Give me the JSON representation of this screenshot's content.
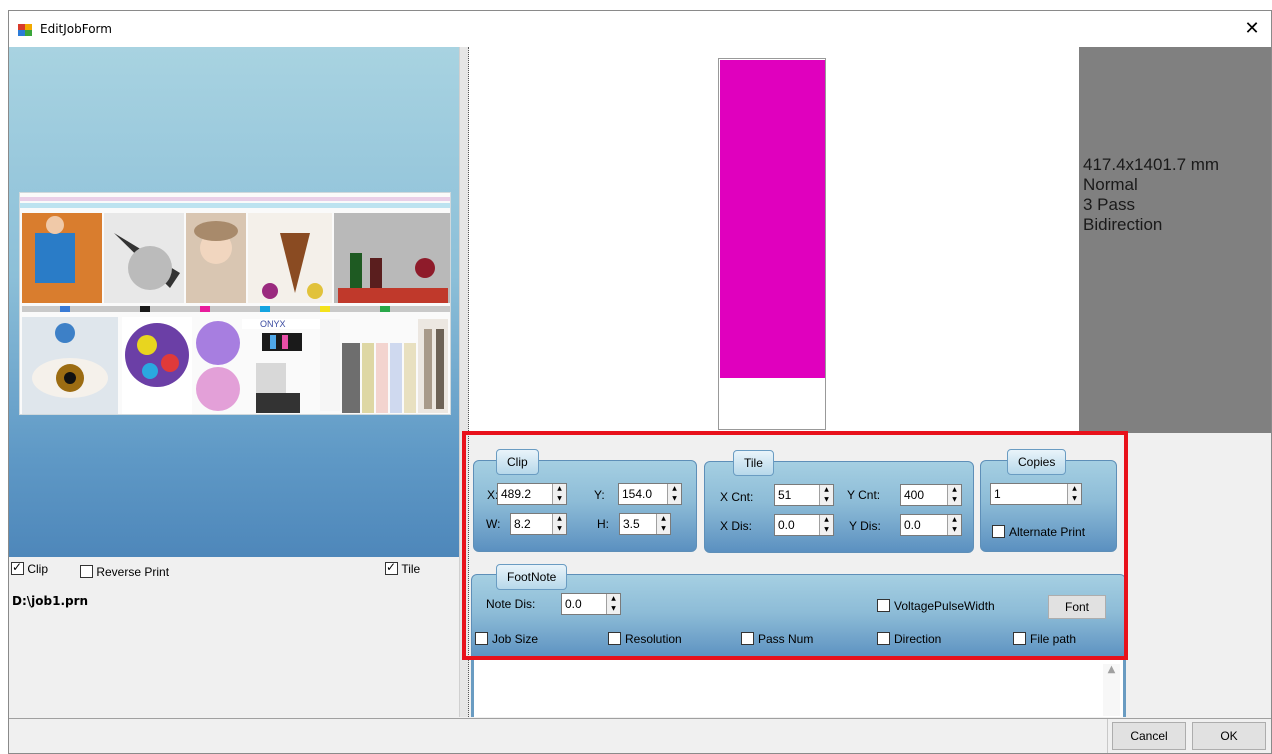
{
  "window": {
    "title": "EditJobForm",
    "close_glyph": "✕"
  },
  "left": {
    "clip_label": "Clip",
    "reverse_label": "Reverse Print",
    "tile_label": "Tile",
    "clip_checked": true,
    "reverse_checked": false,
    "tile_checked": true,
    "filename": "D:\\job1.prn",
    "thumbnail_caption": "ONYX"
  },
  "info": {
    "size": "417.4x1401.7 mm",
    "mode": "Normal",
    "pass": "3 Pass",
    "direction": "Bidirection"
  },
  "clip": {
    "title": "Clip",
    "x_label": "X:",
    "x_value": "489.2",
    "y_label": "Y:",
    "y_value": "154.0",
    "w_label": "W:",
    "w_value": "8.2",
    "h_label": "H:",
    "h_value": "3.5"
  },
  "tile": {
    "title": "Tile",
    "xcnt_label": "X Cnt:",
    "xcnt_value": "51",
    "ycnt_label": "Y Cnt:",
    "ycnt_value": "400",
    "xdis_label": "X Dis:",
    "xdis_value": "0.0",
    "ydis_label": "Y Dis:",
    "ydis_value": "0.0"
  },
  "copies": {
    "title": "Copies",
    "value": "1",
    "alternate_label": "Alternate Print"
  },
  "footnote": {
    "title": "FootNote",
    "note_dis_label": "Note Dis:",
    "note_dis_value": "0.0",
    "voltage_label": "VoltagePulseWidth",
    "font_label": "Font",
    "job_size_label": "Job Size",
    "resolution_label": "Resolution",
    "pass_num_label": "Pass Num",
    "direction_label": "Direction",
    "file_path_label": "File path"
  },
  "buttons": {
    "cancel": "Cancel",
    "ok": "OK"
  },
  "colors": {
    "preview_media": "#e000be",
    "highlight": "#e8111b",
    "info_bg": "#808080"
  }
}
